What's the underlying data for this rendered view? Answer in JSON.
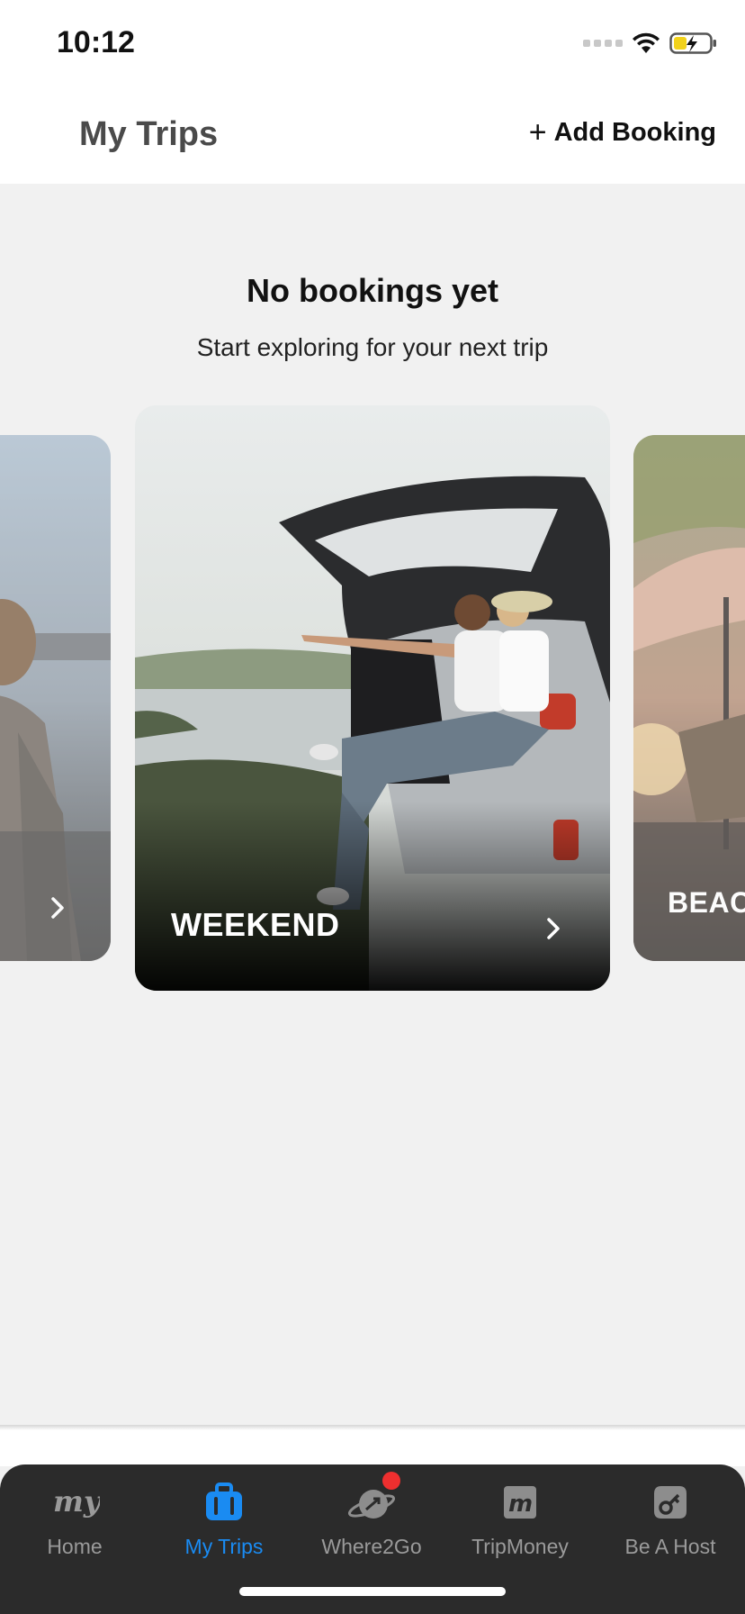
{
  "status_bar": {
    "time": "10:12"
  },
  "header": {
    "title": "My Trips",
    "add_booking_label": "Add Booking"
  },
  "empty_state": {
    "title": "No bookings yet",
    "subtitle": "Start exploring for your next trip"
  },
  "cards": [
    {
      "label": "",
      "theme": "left-partial"
    },
    {
      "label": "WEEKEND",
      "theme": "car-trunk-couple"
    },
    {
      "label": "BEACH",
      "theme": "beach-umbrella"
    }
  ],
  "tabs": [
    {
      "label": "Home",
      "icon": "my-logo-icon",
      "active": false
    },
    {
      "label": "My Trips",
      "icon": "suitcase-icon",
      "active": true
    },
    {
      "label": "Where2Go",
      "icon": "globe-plane-icon",
      "active": false,
      "notification": true
    },
    {
      "label": "TripMoney",
      "icon": "money-m-icon",
      "active": false
    },
    {
      "label": "Be A Host",
      "icon": "key-icon",
      "active": false
    }
  ],
  "colors": {
    "active_tab": "#1a8bf2",
    "inactive_tab": "#9a9a9a",
    "tab_bar_bg": "#2b2b2b",
    "notification": "#ee2f2f",
    "page_bg": "#f1f1f1"
  }
}
